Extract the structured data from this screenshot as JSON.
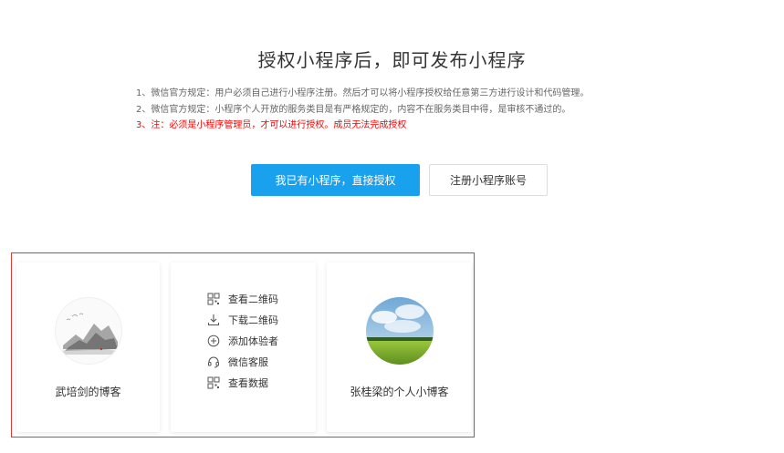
{
  "header": {
    "title": "授权小程序后，即可发布小程序"
  },
  "rules": [
    "1、微信官方规定：用户必须自己进行小程序注册。然后才可以将小程序授权给任意第三方进行设计和代码管理。",
    "2、微信官方规定：小程序个人开放的服务类目是有严格规定的，内容不在服务类目中得，是审核不通过的。",
    "3、注：必须是小程序管理员，才可以进行授权。成员无法完成授权"
  ],
  "buttons": {
    "authorize": "我已有小程序，直接授权",
    "register": "注册小程序账号"
  },
  "cards": {
    "left_name": "武培剑的博客",
    "right_name": "张桂梁的个人小博客"
  },
  "menu": [
    {
      "label": "查看二维码",
      "icon": "qr-code-icon"
    },
    {
      "label": "下载二维码",
      "icon": "download-icon"
    },
    {
      "label": "添加体验者",
      "icon": "add-circle-icon"
    },
    {
      "label": "微信客服",
      "icon": "headset-icon"
    },
    {
      "label": "查看数据",
      "icon": "data-grid-icon"
    }
  ],
  "colors": {
    "primary": "#1aa1ee",
    "warning": "#ff0000",
    "highlight_border": "#e53935"
  }
}
